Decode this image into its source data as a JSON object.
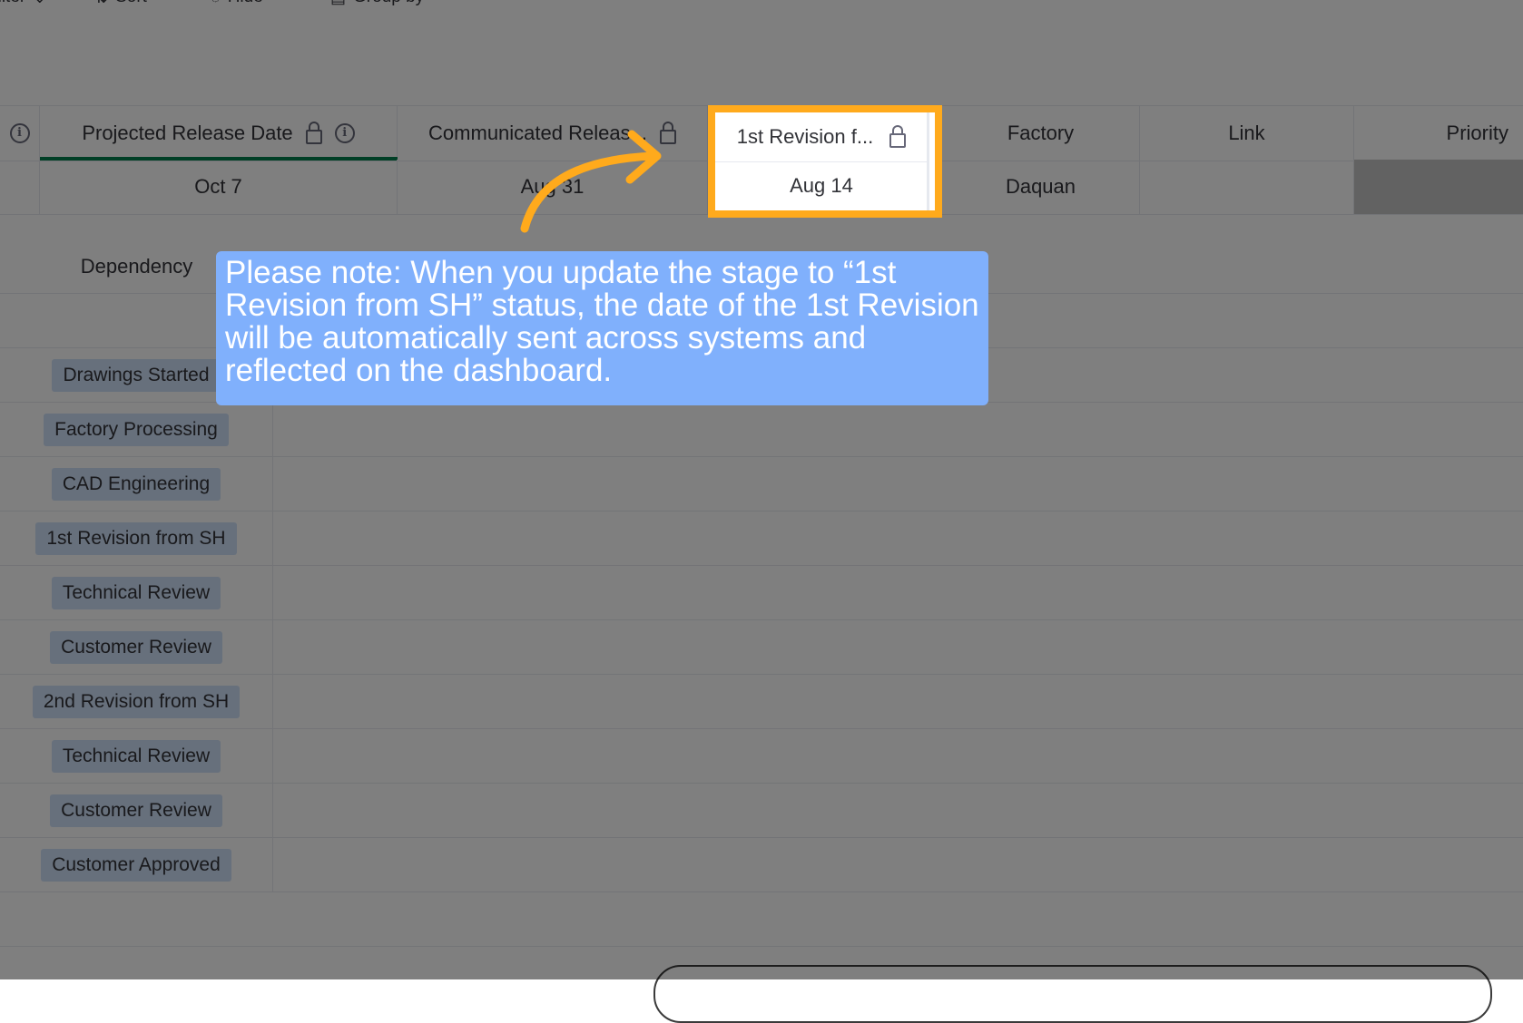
{
  "toolbar": {
    "filter_label": "Filter",
    "sort_label": "Sort",
    "hide_label": "Hide",
    "group_by_label": "Group by"
  },
  "columns": {
    "projected_release": "Projected Release Date",
    "communicated_release": "Communicated Releas...",
    "first_revision": "1st Revision f...",
    "factory": "Factory",
    "link": "Link",
    "priority": "Priority"
  },
  "row": {
    "projected_release": "Oct 7",
    "communicated_release": "Aug 31",
    "first_revision": "Aug 14",
    "factory": "Daquan",
    "link": ""
  },
  "subtable": {
    "header": "Dependency",
    "items": [
      "Drawings Started",
      "Factory Processing",
      "CAD Engineering",
      "1st Revision from SH",
      "Technical Review",
      "Customer Review",
      "2nd Revision from SH",
      "Technical Review",
      "Customer Review",
      "Customer Approved"
    ]
  },
  "callout": {
    "text": "Please note: When you update the stage to “1st Revision from SH” status, the date of the 1st Revision will be automatically sent across systems and reflected on the dashboard."
  },
  "colors": {
    "highlight": "#ffaa1c",
    "callout_bg": "#80b0fc",
    "chip_bg": "#cfe1f8",
    "active_column_underline": "#037f4c"
  }
}
